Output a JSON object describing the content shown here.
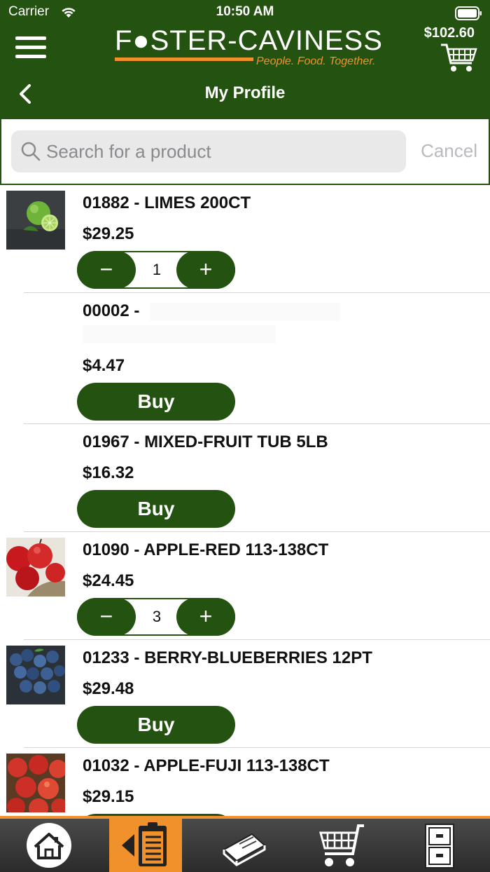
{
  "status": {
    "carrier": "Carrier",
    "time": "10:50 AM"
  },
  "header": {
    "brand": "F●STER-CAVINESS",
    "tagline": "People. Food. Together.",
    "cart_total": "$102.60",
    "title": "My Profile"
  },
  "search": {
    "placeholder": "Search for a product",
    "cancel_label": "Cancel"
  },
  "products": [
    {
      "name": "01882 - LIMES 200CT",
      "price": "$29.25",
      "action": "stepper",
      "quantity": "1",
      "image": "limes"
    },
    {
      "name": "00002 -",
      "price": "$4.47",
      "action": "buy",
      "buy_label": "Buy"
    },
    {
      "name": "01967 - MIXED-FRUIT TUB 5LB",
      "price": "$16.32",
      "action": "buy",
      "buy_label": "Buy"
    },
    {
      "name": "01090 - APPLE-RED 113-138CT",
      "price": "$24.45",
      "action": "stepper",
      "quantity": "3",
      "image": "red-apples"
    },
    {
      "name": "01233 - BERRY-BLUEBERRIES 12PT",
      "price": "$29.48",
      "action": "buy",
      "buy_label": "Buy",
      "image": "blueberries"
    },
    {
      "name": "01032 - APPLE-FUJI 113-138CT",
      "price": "$29.15",
      "action": "buy",
      "image": "fuji-apples"
    }
  ],
  "stepper_symbols": {
    "minus": "−",
    "plus": "+"
  },
  "tabs": [
    {
      "icon": "home-icon",
      "active": false
    },
    {
      "icon": "order-guide-icon",
      "active": true
    },
    {
      "icon": "catalog-book-icon",
      "active": false
    },
    {
      "icon": "cart-icon",
      "active": false
    },
    {
      "icon": "filing-cabinet-icon",
      "active": false
    }
  ],
  "colors": {
    "brand_green": "#245311",
    "accent_orange": "#f0912b",
    "search_bg": "#e9e9ea"
  }
}
